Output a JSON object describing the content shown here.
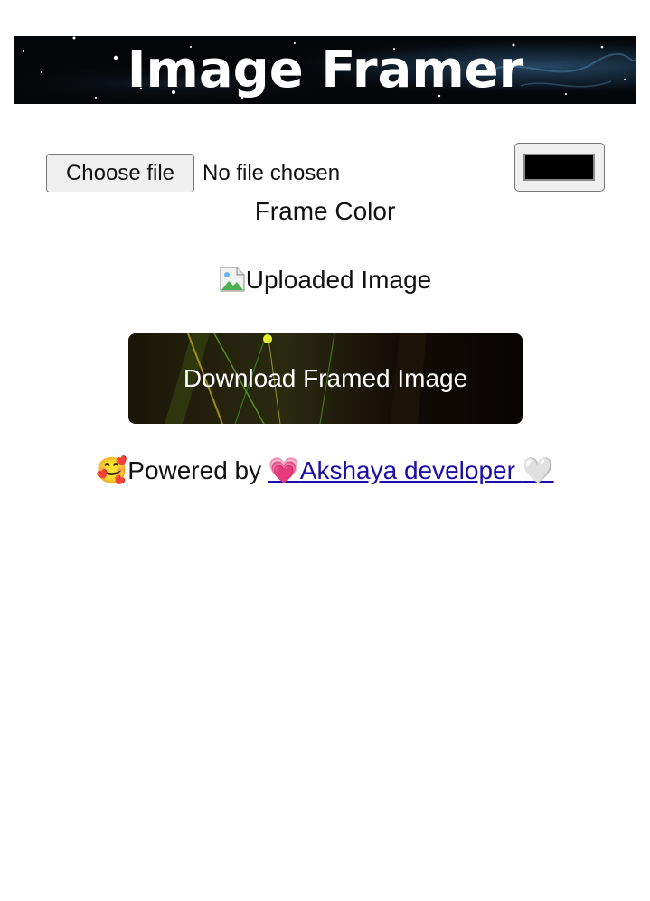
{
  "header": {
    "title": "Image Framer"
  },
  "file_input": {
    "button_label": "Choose file",
    "status": "No file chosen"
  },
  "color_picker": {
    "value": "#000000",
    "label": "Frame Color"
  },
  "preview": {
    "alt_text": "Uploaded Image",
    "icon": "broken-image-icon"
  },
  "download": {
    "label": "Download Framed Image"
  },
  "footer": {
    "lead_emoji": "🥰",
    "prefix": "Powered by ",
    "link_emoji_start": "💗",
    "link_text": "Akshaya developer ",
    "link_emoji_end": "🤍"
  },
  "colors": {
    "link": "#1a0dab",
    "text": "#111111",
    "header_bg": "#050608",
    "button_bg": "#0b0805"
  }
}
